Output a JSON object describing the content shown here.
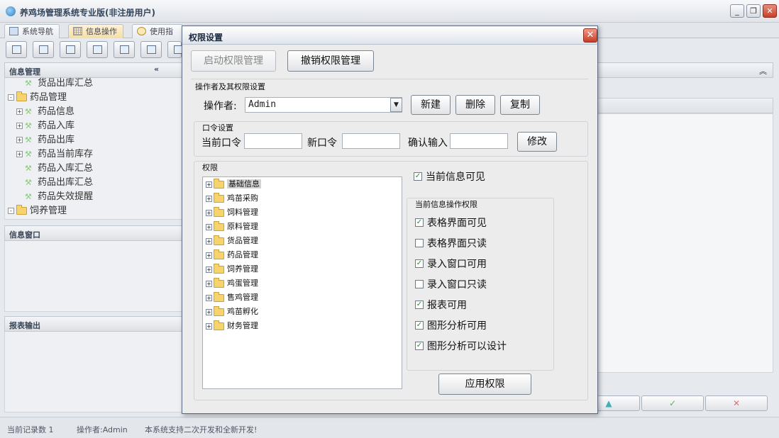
{
  "app": {
    "title": "养鸡场管理系统专业版(非注册用户)",
    "win_minimize": "_",
    "win_restore": "❐",
    "win_close": "✕"
  },
  "tabs": [
    {
      "label": "系统导航"
    },
    {
      "label": "信息操作"
    },
    {
      "label": "使用指南"
    }
  ],
  "left": {
    "pane1_title": "信息管理",
    "pane1_collapse": "«",
    "tree": [
      {
        "label": "货品出库汇总",
        "type": "leaf",
        "indent": 2
      },
      {
        "label": "药品管理",
        "type": "folder",
        "expand": "-",
        "indent": 0
      },
      {
        "label": "药品信息",
        "type": "leaf-plus",
        "expand": "+",
        "indent": 1
      },
      {
        "label": "药品入库",
        "type": "leaf-plus",
        "expand": "+",
        "indent": 1
      },
      {
        "label": "药品出库",
        "type": "leaf-plus",
        "expand": "+",
        "indent": 1
      },
      {
        "label": "药品当前库存",
        "type": "leaf-plus",
        "expand": "+",
        "indent": 1
      },
      {
        "label": "药品入库汇总",
        "type": "leaf",
        "indent": 2
      },
      {
        "label": "药品出库汇总",
        "type": "leaf",
        "indent": 2
      },
      {
        "label": "药品失效提醒",
        "type": "leaf",
        "indent": 2
      },
      {
        "label": "饲养管理",
        "type": "folder",
        "expand": "-",
        "indent": 0
      }
    ],
    "pane2_title": "信息窗口",
    "pane3_title": "报表输出"
  },
  "right": {
    "collapse": "︽",
    "nav_up": "▲",
    "nav_ok": "✓",
    "nav_cancel": "✕"
  },
  "status": {
    "records": "当前记录数 1",
    "operator": "操作者:Admin",
    "message": "本系统支持二次开发和全新开发!"
  },
  "dialog": {
    "title": "权限设置",
    "close": "✕",
    "start_btn": "启动权限管理",
    "cancel_btn": "撤销权限管理",
    "operator_section": "操作者及其权限设置",
    "operator_label": "操作者:",
    "operator_value": "Admin",
    "combo_arrow": "▼",
    "new_btn": "新建",
    "delete_btn": "删除",
    "copy_btn": "复制",
    "password_section": "口令设置",
    "current_pwd_label": "当前口令",
    "new_pwd_label": "新口令",
    "confirm_pwd_label": "确认输入",
    "modify_btn": "修改",
    "permission_section": "权限",
    "permission_tree": [
      "基础信息",
      "鸡苗采购",
      "饲料管理",
      "原料管理",
      "货品管理",
      "药品管理",
      "饲养管理",
      "鸡蛋管理",
      "售鸡管理",
      "鸡苗孵化",
      "财务管理"
    ],
    "expand_symbol": "+",
    "current_visible_label": "当前信息可见",
    "ops_section": "当前信息操作权限",
    "ops": [
      {
        "label": "表格界面可见",
        "checked": true
      },
      {
        "label": "表格界面只读",
        "checked": false
      },
      {
        "label": "录入窗口可用",
        "checked": true
      },
      {
        "label": "录入窗口只读",
        "checked": false
      },
      {
        "label": "报表可用",
        "checked": true
      },
      {
        "label": "图形分析可用",
        "checked": true
      },
      {
        "label": "图形分析可以设计",
        "checked": true
      }
    ],
    "check_mark": "✓",
    "apply_btn": "应用权限"
  }
}
